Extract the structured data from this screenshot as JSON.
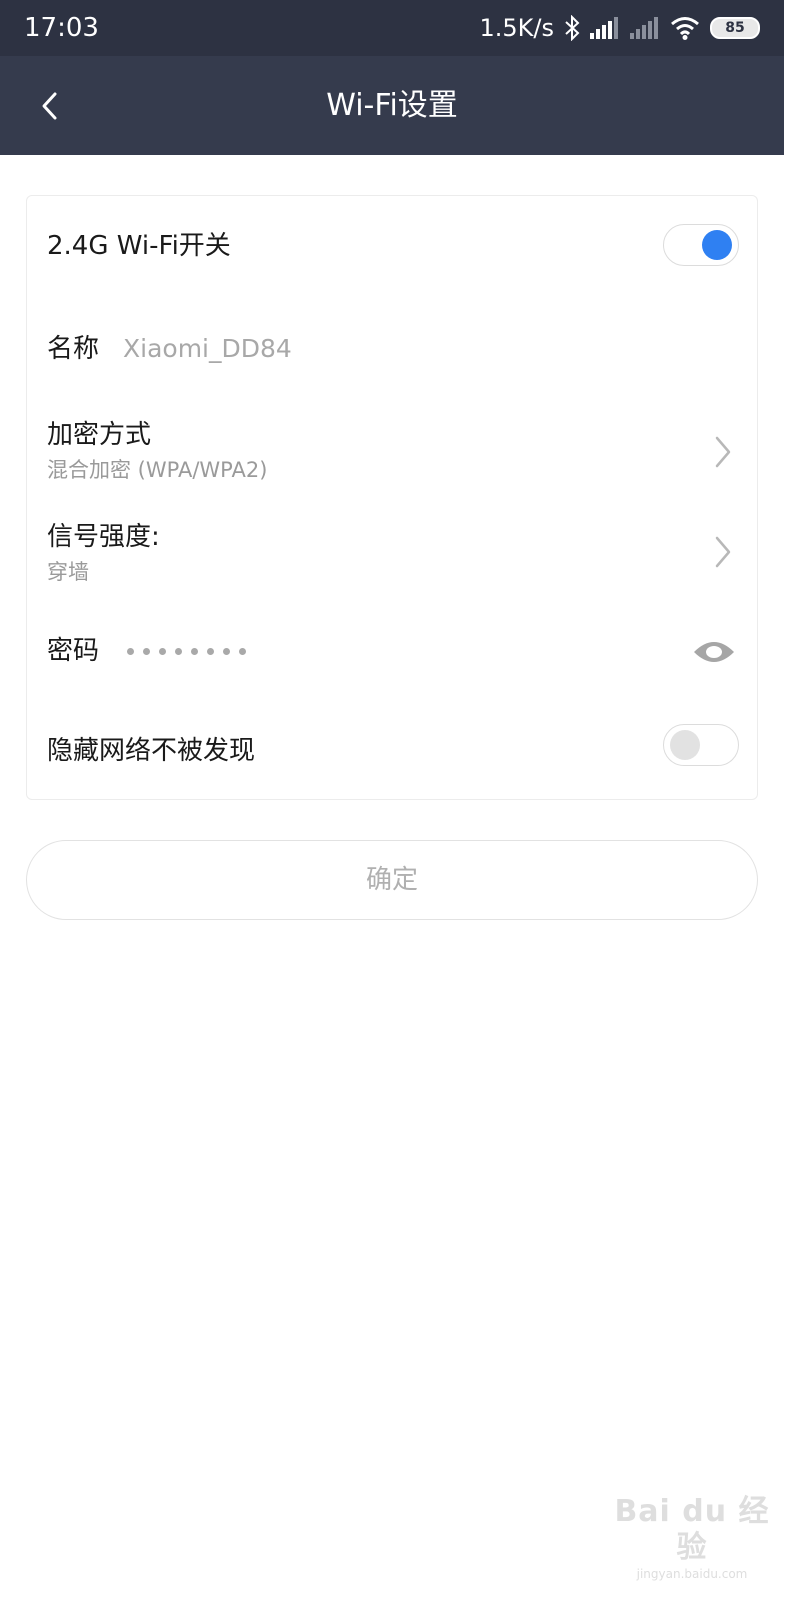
{
  "status_bar": {
    "time": "17:03",
    "network_speed": "1.5K/s",
    "battery": "85",
    "icons": [
      "bluetooth-icon",
      "signal-icon",
      "signal-weak-icon",
      "wifi-icon",
      "battery-icon"
    ]
  },
  "nav": {
    "back_icon": "chevron-left-icon",
    "title": "Wi-Fi设置"
  },
  "settings": {
    "wifi_switch": {
      "label": "2.4G Wi-Fi开关",
      "on": true
    },
    "name": {
      "label": "名称",
      "value": "Xiaomi_DD84"
    },
    "encryption": {
      "label": "加密方式",
      "value": "混合加密 (WPA/WPA2)"
    },
    "signal_strength": {
      "label": "信号强度:",
      "value": "穿墙"
    },
    "password": {
      "label": "密码",
      "masked_length": 8,
      "reveal_icon": "eye-icon"
    },
    "hide_network": {
      "label": "隐藏网络不被发现",
      "on": false
    }
  },
  "confirm_button": {
    "label": "确定"
  },
  "watermark": {
    "logo": "Bai du 经验",
    "url": "jingyan.baidu.com"
  },
  "colors": {
    "status_bar_bg": "#2d3242",
    "nav_bg": "#353b4d",
    "accent": "#2f80f2"
  }
}
